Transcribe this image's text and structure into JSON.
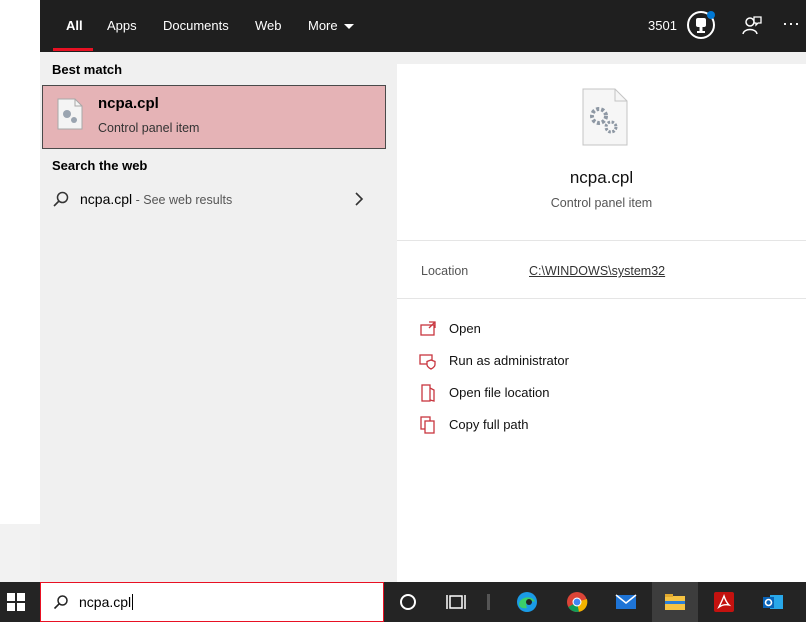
{
  "tabs": [
    {
      "label": "All"
    },
    {
      "label": "Apps"
    },
    {
      "label": "Documents"
    },
    {
      "label": "Web"
    },
    {
      "label": "More"
    }
  ],
  "header": {
    "points": "3501"
  },
  "best_match": {
    "section": "Best match",
    "title": "ncpa.cpl",
    "subtitle": "Control panel item"
  },
  "web": {
    "section": "Search the web",
    "query": "ncpa.cpl",
    "suffix": " - See web results"
  },
  "details": {
    "title": "ncpa.cpl",
    "subtitle": "Control panel item",
    "location_label": "Location",
    "location_value": "C:\\WINDOWS\\system32"
  },
  "actions": [
    {
      "label": "Open",
      "icon": "open-icon"
    },
    {
      "label": "Run as administrator",
      "icon": "shield-icon"
    },
    {
      "label": "Open file location",
      "icon": "folder-icon"
    },
    {
      "label": "Copy full path",
      "icon": "copy-icon"
    }
  ],
  "taskbar": {
    "search_value": "ncpa.cpl",
    "apps": [
      "cortana-icon",
      "task-view-icon",
      "edge-icon",
      "chrome-icon",
      "mail-icon",
      "file-explorer-icon",
      "acrobat-icon",
      "outlook-icon"
    ]
  },
  "colors": {
    "accent": "#e81123",
    "selection": "#e5b3b6",
    "topbar": "#1f1f1f",
    "taskbar": "#242424"
  }
}
